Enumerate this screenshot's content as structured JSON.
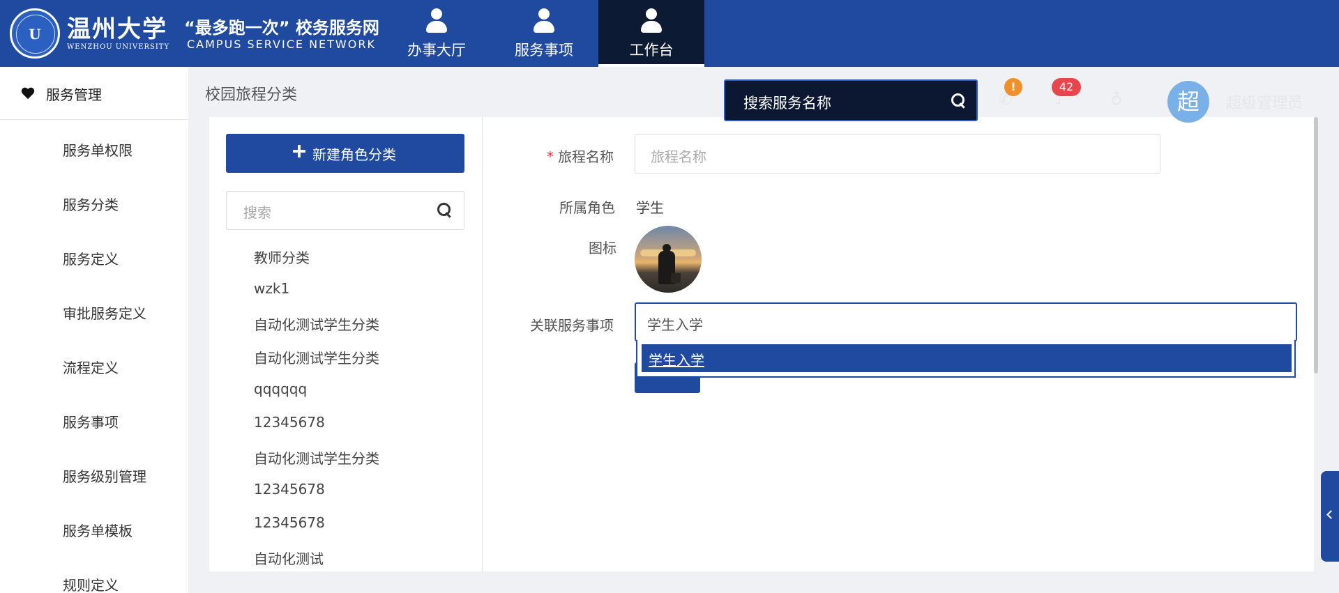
{
  "header": {
    "university_name": "温州大学",
    "university_en": "WENZHOU UNIVERSITY",
    "site_title": "“最多跑一次” 校务服务网",
    "site_subtitle": "CAMPUS SERVICE NETWORK",
    "nav": [
      {
        "label": "办事大厅",
        "icon": "user-icon",
        "active": false
      },
      {
        "label": "服务事项",
        "icon": "user-icon",
        "active": false
      },
      {
        "label": "工作台",
        "icon": "user-icon",
        "active": true
      }
    ]
  },
  "sidebar": {
    "section_icon": "heart-icon",
    "section_title": "服务管理",
    "items": [
      {
        "label": "服务单权限"
      },
      {
        "label": "服务分类"
      },
      {
        "label": "服务定义"
      },
      {
        "label": "审批服务定义"
      },
      {
        "label": "流程定义"
      },
      {
        "label": "服务事项"
      },
      {
        "label": "服务级别管理"
      },
      {
        "label": "服务单模板"
      },
      {
        "label": "规则定义"
      }
    ]
  },
  "page": {
    "title": "校园旅程分类"
  },
  "topsearch": {
    "placeholder": "搜索服务名称",
    "icon": "search-icon"
  },
  "toolbar": {
    "alert_badge": "!",
    "notification_count": "42",
    "phone_icon": "phone-icon",
    "bell_icon": "bell-icon",
    "stethoscope_icon": "stethoscope-icon"
  },
  "user": {
    "avatar_initial": "超",
    "name": "超级管理员"
  },
  "category_panel": {
    "new_button_label": "新建角色分类",
    "search_placeholder": "搜索",
    "items": [
      {
        "label": "教师分类"
      },
      {
        "label": "wzk1"
      },
      {
        "label": "自动化测试学生分类"
      },
      {
        "label": "自动化测试学生分类"
      },
      {
        "label": "qqqqqq"
      },
      {
        "label": "12345678"
      },
      {
        "label": "自动化测试学生分类"
      },
      {
        "label": "12345678"
      },
      {
        "label": "12345678"
      },
      {
        "label": "自动化测试"
      }
    ]
  },
  "form": {
    "journey_name_label": "旅程名称",
    "journey_name_placeholder": "旅程名称",
    "required_mark": "*",
    "role_label": "所属角色",
    "role_value": "学生",
    "icon_label": "图标",
    "related_label": "关联服务事项",
    "related_value": "学生入学",
    "dropdown_options": [
      {
        "label": "学生入学",
        "highlighted": true
      }
    ]
  },
  "colors": {
    "primary": "#1f4aa0",
    "active_nav": "#0d1a33",
    "badge_orange": "#f0902b",
    "badge_red": "#e8464d",
    "avatar": "#7ab0e8"
  }
}
